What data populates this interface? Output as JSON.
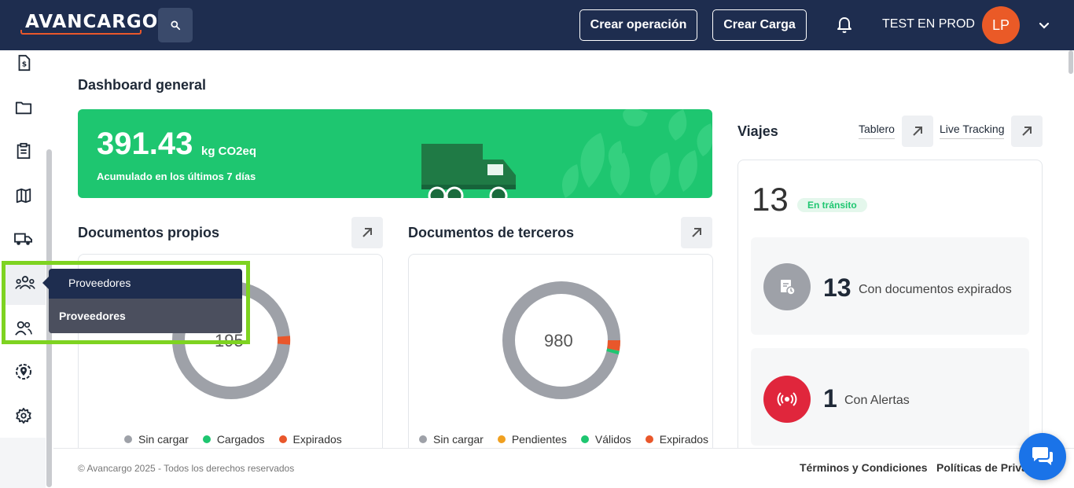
{
  "header": {
    "logo_text": "AVANCARGO",
    "create_operation_label": "Crear operación",
    "create_cargo_label": "Crear Carga",
    "user_name": "TEST EN PROD",
    "avatar_initials": "LP"
  },
  "sidebar": {
    "icons": [
      "invoice-icon",
      "folder-icon",
      "clipboard-icon",
      "map-icon",
      "truck-icon",
      "providers-icon",
      "users-icon",
      "location-icon",
      "gear-icon"
    ]
  },
  "tooltip": {
    "title": "Proveedores",
    "item": "Proveedores"
  },
  "dashboard": {
    "title": "Dashboard general",
    "co2": {
      "value": "391.43",
      "unit": "kg CO2eq",
      "subtitle": "Acumulado en los últimos 7 días"
    },
    "own_docs": {
      "title": "Documentos propios",
      "total": "195",
      "legend": [
        {
          "label": "Sin cargar",
          "color": "#9ea1a8"
        },
        {
          "label": "Cargados",
          "color": "#1ec670"
        },
        {
          "label": "Expirados",
          "color": "#e9572b"
        }
      ]
    },
    "third_docs": {
      "title": "Documentos de terceros",
      "total": "980",
      "legend": [
        {
          "label": "Sin cargar",
          "color": "#9ea1a8"
        },
        {
          "label": "Pendientes",
          "color": "#f0a020"
        },
        {
          "label": "Válidos",
          "color": "#1ec670"
        },
        {
          "label": "Expirados",
          "color": "#e9572b"
        }
      ]
    },
    "viajes": {
      "title": "Viajes",
      "tablero_label": "Tablero",
      "tracking_label": "Live Tracking",
      "in_transit_count": "13",
      "in_transit_label": "En tránsito",
      "expired_docs_count": "13",
      "expired_docs_label": "Con documentos expirados",
      "alerts_count": "1",
      "alerts_label": "Con Alertas"
    }
  },
  "footer": {
    "copyright": "© Avancargo 2025 - Todos los derechos reservados",
    "terms": "Términos y Condiciones",
    "privacy": "Políticas de Priva"
  },
  "colors": {
    "navy": "#1e2d4f",
    "accent_orange": "#e9572b",
    "green": "#1ec670",
    "alert_red": "#e0263c",
    "highlight_green": "#7ed321"
  }
}
